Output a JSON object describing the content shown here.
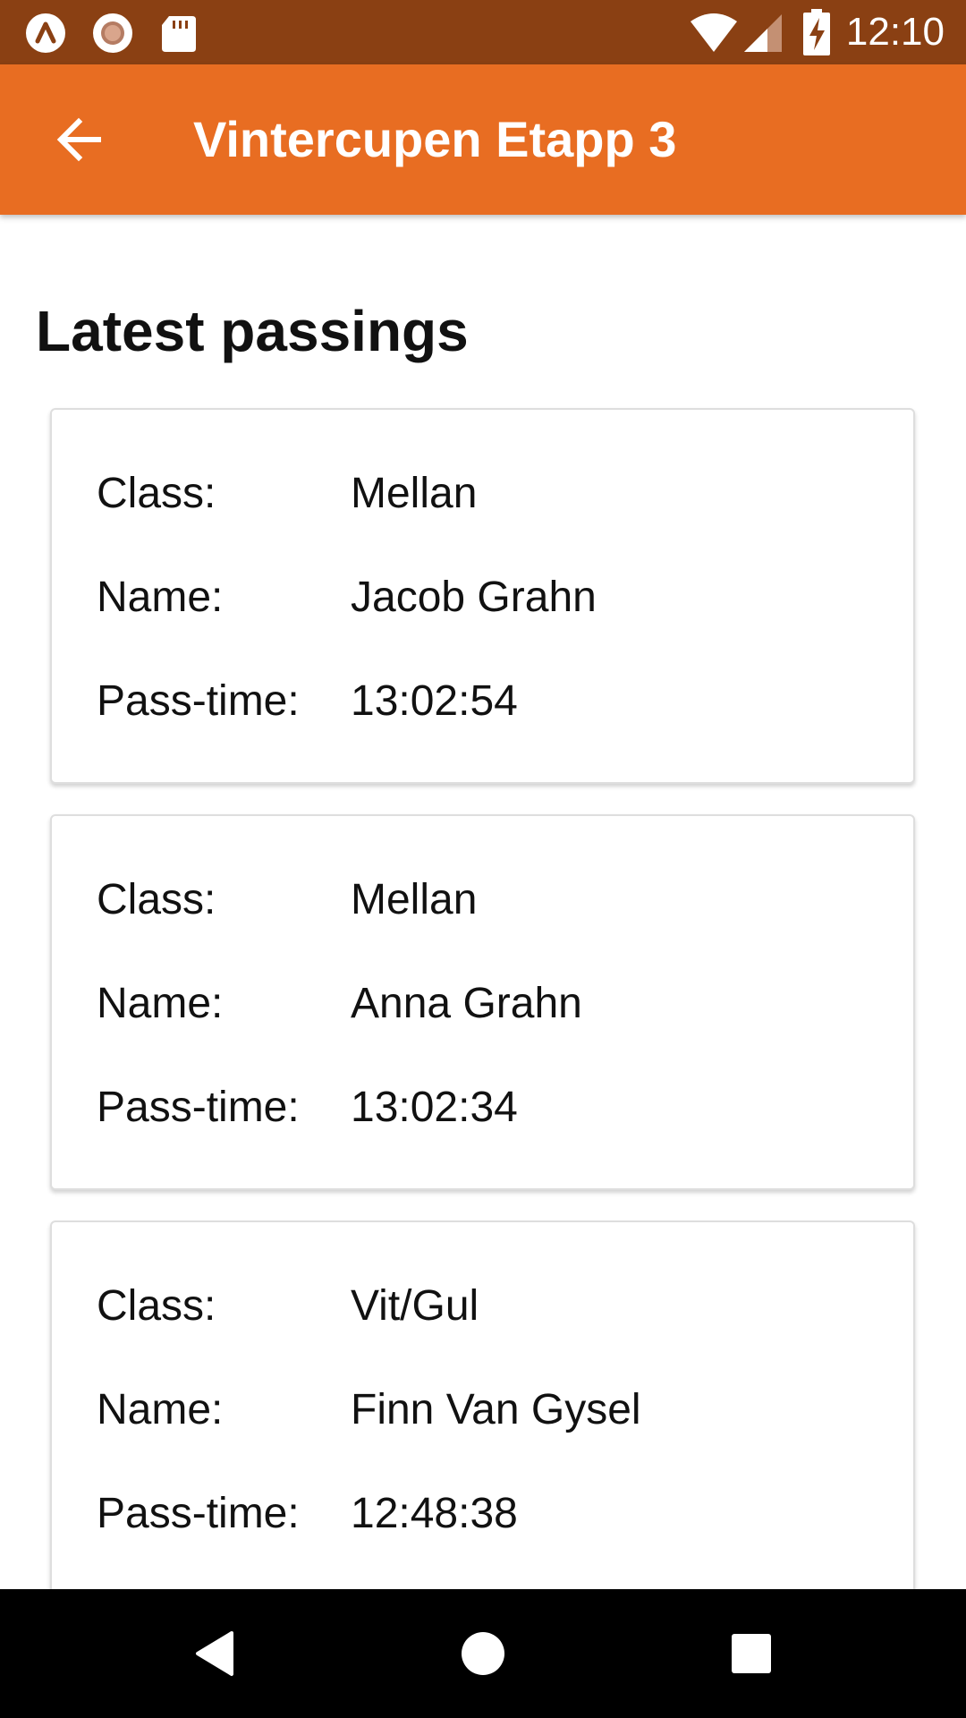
{
  "status_bar": {
    "time": "12:10",
    "icons": [
      "launcher-icon",
      "record-icon",
      "sd-card-icon",
      "wifi-icon",
      "signal-icon",
      "battery-charging-icon"
    ],
    "background": "#8a4013"
  },
  "app_bar": {
    "title": "Vintercupen Etapp 3",
    "back_icon": "arrow-back-icon",
    "background": "#e86d22"
  },
  "main": {
    "heading": "Latest passings",
    "passings": [
      {
        "class_label": "Class:",
        "class": "Mellan",
        "name_label": "Name:",
        "name": "Jacob Grahn",
        "time_label": "Pass-time:",
        "time": "13:02:54"
      },
      {
        "class_label": "Class:",
        "class": "Mellan",
        "name_label": "Name:",
        "name": "Anna Grahn",
        "time_label": "Pass-time:",
        "time": "13:02:34"
      },
      {
        "class_label": "Class:",
        "class": "Vit/Gul",
        "name_label": "Name:",
        "name": "Finn Van Gysel",
        "time_label": "Pass-time:",
        "time": "12:48:38"
      }
    ]
  },
  "nav_bar": {
    "icons": [
      "back-triangle-icon",
      "home-circle-icon",
      "recents-square-icon"
    ]
  }
}
